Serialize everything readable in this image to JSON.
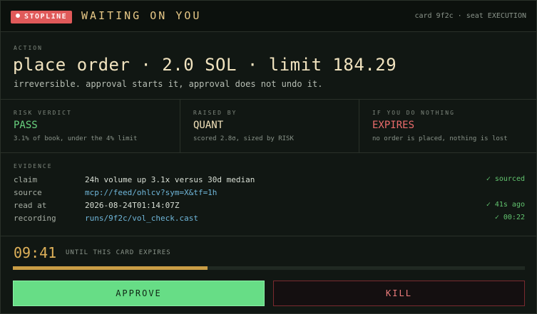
{
  "header": {
    "badge": "STOPLINE",
    "title": "WAITING ON YOU",
    "meta": "card 9f2c · seat EXECUTION"
  },
  "action": {
    "label": "ACTION",
    "title": "place order · 2.0 SOL · limit 184.29",
    "subtitle": "irreversible. approval starts it, approval does not undo it."
  },
  "verdicts": [
    {
      "label": "RISK VERDICT",
      "value": "PASS",
      "note": "3.1% of book, under the 4% limit",
      "color": "#69d27f"
    },
    {
      "label": "RAISED BY",
      "value": "QUANT",
      "note": "scored 2.8σ, sized by RISK",
      "color": "#f0e0b8"
    },
    {
      "label": "IF YOU DO NOTHING",
      "value": "EXPIRES",
      "note": "no order is placed, nothing is lost",
      "color": "#ea6b6b"
    }
  ],
  "evidence": {
    "label": "EVIDENCE",
    "rows": [
      {
        "key": "claim",
        "value": "24h volume up 3.1x versus 30d median",
        "status": "✓ sourced"
      },
      {
        "key": "source",
        "value": "mcp://feed/ohlcv?sym=X&tf=1h",
        "status": ""
      },
      {
        "key": "read at",
        "value": "2026-08-24T01:14:07Z",
        "status": "✓ 41s ago"
      },
      {
        "key": "recording",
        "value": "runs/9f2c/vol_check.cast",
        "status": "✓ 00:22"
      }
    ]
  },
  "timer": {
    "value": "09:41",
    "label": "UNTIL THIS CARD EXPIRES",
    "progress": 0.38
  },
  "buttons": {
    "approve": "APPROVE",
    "kill": "KILL"
  },
  "colors": {
    "accent": "#e8c987",
    "approve": "#67dd86",
    "kill": "#ef7d7d",
    "stopline": "#e05a5a"
  }
}
